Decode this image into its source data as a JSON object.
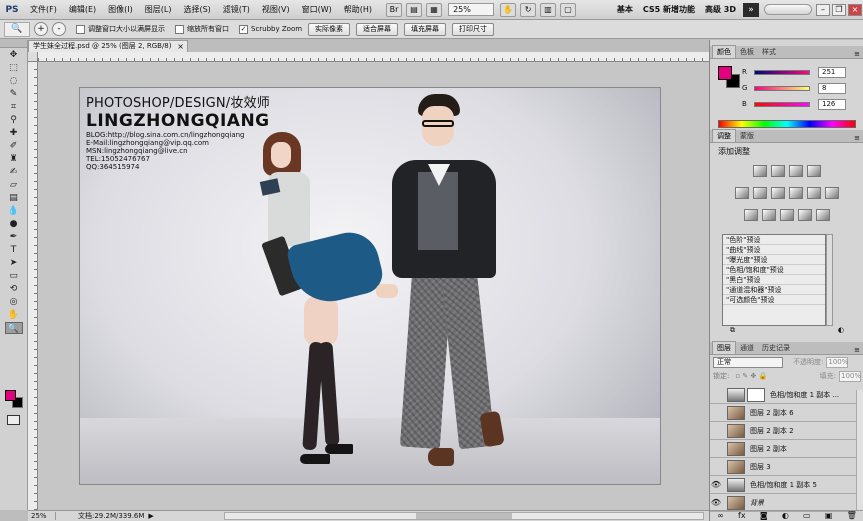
{
  "app": {
    "logo": "PS"
  },
  "menu": [
    "文件(F)",
    "编辑(E)",
    "图像(I)",
    "图层(L)",
    "选择(S)",
    "滤镜(T)",
    "视图(V)",
    "窗口(W)",
    "帮助(H)"
  ],
  "menubar_tools": {
    "zoom_value": "25%"
  },
  "workspaces": [
    "基本",
    "CS5 新增功能",
    "高级 3D"
  ],
  "workspace_more": "»",
  "options": {
    "zoom_in_icon": "+",
    "zoom_out_icon": "-",
    "resize_windows": "调整窗口大小以满屏显示",
    "zoom_all_windows": "缩放所有窗口",
    "scrubby_zoom": "Scrubby Zoom",
    "scrubby_checked": "✓",
    "btn_actual_pixels": "实际像素",
    "btn_fit_screen": "适合屏幕",
    "btn_fill_screen": "填充屏幕",
    "btn_print_size": "打印尺寸"
  },
  "document": {
    "tab_title": "学生妹全过程.psd @ 25% (图层 2, RGB/8)",
    "tab_close": "×"
  },
  "photo_text": {
    "line1": "PHOTOSHOP/DESIGN/妆效师",
    "line2": "LINGZHONGQIANG",
    "blog": "BLOG:http://blog.sina.com.cn/lingzhongqiang",
    "email": "E-Mail:lingzhongqiang@vip.qq.com",
    "msn": "MSN:lingzhongqiang@live.cn",
    "tel": "TEL:15052476767",
    "qq": "QQ:364515974"
  },
  "status": {
    "zoom": "25%",
    "doc_size": "文档:29.2M/339.6M",
    "arrow": "▶"
  },
  "color_panel": {
    "tabs": [
      "颜色",
      "色板",
      "样式"
    ],
    "r_label": "R",
    "r_value": "251",
    "g_label": "G",
    "g_value": "8",
    "b_label": "B",
    "b_value": "126",
    "fg_color": "#e5007f"
  },
  "adjustments_panel": {
    "tabs": [
      "调整",
      "蒙版"
    ],
    "title": "添加调整",
    "presets": [
      "\"色阶\"预设",
      "\"曲线\"预设",
      "\"曝光度\"预设",
      "\"色相/饱和度\"预设",
      "\"黑白\"预设",
      "\"通道混和器\"预设",
      "\"可选颜色\"预设"
    ]
  },
  "layers_panel": {
    "tabs": [
      "图层",
      "通道",
      "历史记录"
    ],
    "blend_mode": "正常",
    "opacity_label": "不透明度:",
    "opacity_value": "100%",
    "lock_label": "锁定:",
    "fill_label": "填充:",
    "fill_value": "100%",
    "layers": [
      {
        "name": "色相/饱和度 1 副本 ...",
        "visible": false,
        "kind": "adjust"
      },
      {
        "name": "图层 2 副本 6",
        "visible": false,
        "kind": "photo"
      },
      {
        "name": "图层 2 副本 2",
        "visible": false,
        "kind": "photo"
      },
      {
        "name": "图层 2 副本",
        "visible": false,
        "kind": "photo"
      },
      {
        "name": "图层 3",
        "visible": false,
        "kind": "photo"
      },
      {
        "name": "色相/饱和度 1 副本 5",
        "visible": true,
        "kind": "adjust"
      },
      {
        "name": "背景",
        "visible": true,
        "kind": "photo"
      }
    ],
    "eye_icon": "👁",
    "footer_icons": [
      "∞",
      "fx",
      "◙",
      "◐",
      "▭",
      "▣",
      "🗑"
    ]
  }
}
